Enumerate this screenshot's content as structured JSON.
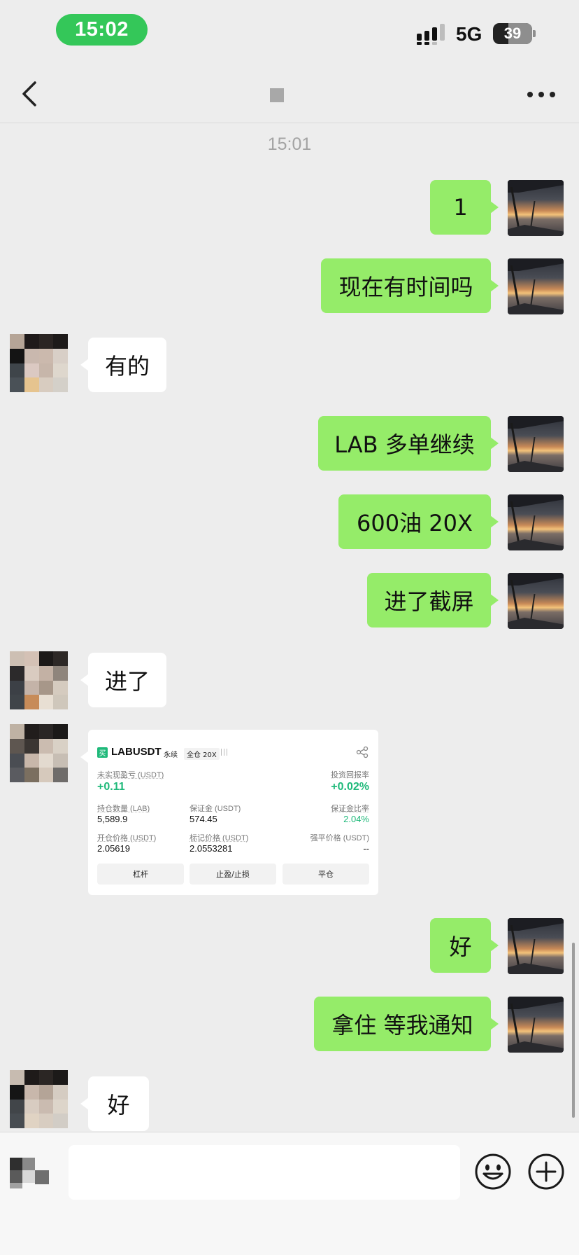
{
  "status_bar": {
    "time": "15:02",
    "network": "5G",
    "battery": "39",
    "battery_level": 0.39
  },
  "nav": {
    "title": ""
  },
  "timestamp": "15:01",
  "messages": [
    {
      "side": "sent",
      "text": "1"
    },
    {
      "side": "sent",
      "text": "现在有时间吗"
    },
    {
      "side": "recv",
      "text": "有的"
    },
    {
      "side": "sent",
      "text": "LAB 多单继续"
    },
    {
      "side": "sent",
      "text": "600油 20X"
    },
    {
      "side": "sent",
      "text": "进了截屏"
    },
    {
      "side": "recv",
      "text": "进了"
    },
    {
      "side": "sent",
      "text": "好"
    },
    {
      "side": "sent",
      "text": "拿住 等我通知"
    },
    {
      "side": "recv",
      "text": "好"
    }
  ],
  "position_card": {
    "buy_tag": "买",
    "symbol": "LABUSDT",
    "contract_type": "永续",
    "margin_mode": "全仓 20X",
    "unrealized_pnl_label": "未实现盈亏 (USDT)",
    "unrealized_pnl": "+0.11",
    "roi_label": "投资回报率",
    "roi": "+0.02%",
    "size_label": "持仓数量 (LAB)",
    "size": "5,589.9",
    "margin_label": "保证金 (USDT)",
    "margin": "574.45",
    "margin_ratio_label": "保证金比率",
    "margin_ratio": "2.04%",
    "entry_price_label": "开仓价格 (USDT)",
    "entry_price": "2.05619",
    "mark_price_label": "标记价格 (USDT)",
    "mark_price": "2.0553281",
    "liq_price_label": "强平价格 (USDT)",
    "liq_price": "--",
    "buttons": [
      "杠杆",
      "止盈/止损",
      "平仓"
    ]
  },
  "input_bar": {
    "placeholder": ""
  },
  "colors": {
    "sent_bubble": "#95ec69",
    "recv_bubble": "#ffffff",
    "background": "#ededed",
    "time_pill": "#34c759",
    "profit_green": "#1fb97a"
  },
  "icons": {
    "back": "chevron-left-icon",
    "more": "ellipsis-icon",
    "voice": "voice-icon",
    "emoji": "emoji-icon",
    "plus": "plus-circle-icon",
    "share": "share-icon"
  }
}
